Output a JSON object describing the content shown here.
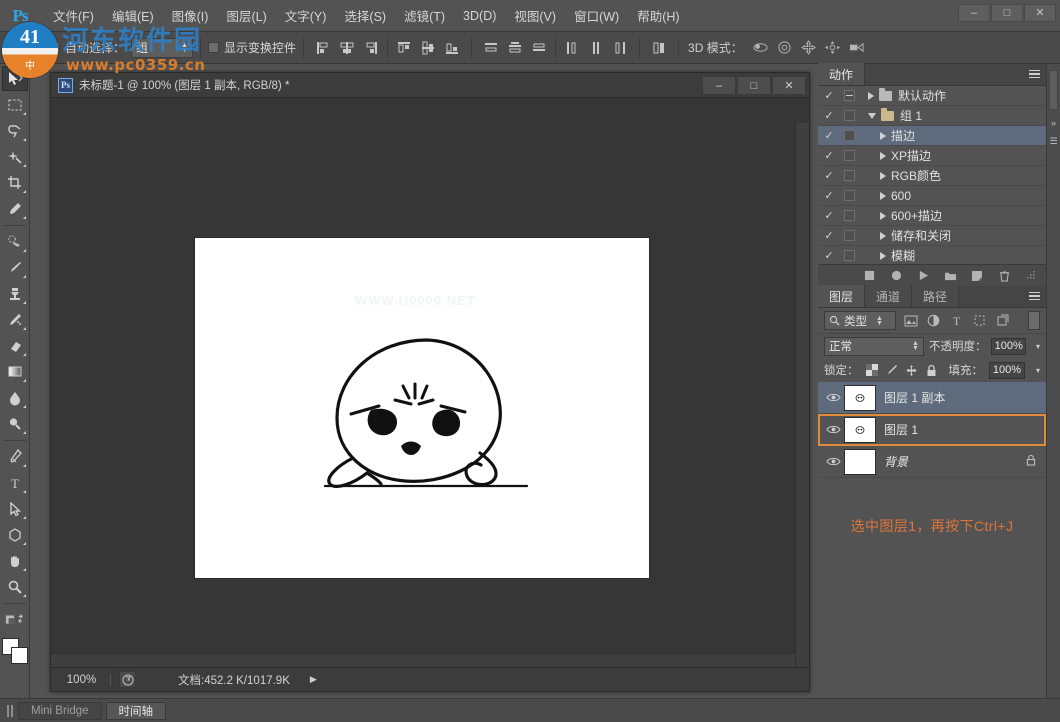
{
  "app": {
    "window_buttons": [
      "–",
      "□",
      "✕"
    ],
    "logo": "Ps"
  },
  "menu": {
    "items": [
      {
        "label": "文件(F)"
      },
      {
        "label": "编辑(E)"
      },
      {
        "label": "图像(I)"
      },
      {
        "label": "图层(L)"
      },
      {
        "label": "文字(Y)"
      },
      {
        "label": "选择(S)"
      },
      {
        "label": "滤镜(T)"
      },
      {
        "label": "3D(D)"
      },
      {
        "label": "视图(V)"
      },
      {
        "label": "窗口(W)"
      },
      {
        "label": "帮助(H)"
      }
    ]
  },
  "options_bar": {
    "auto_select_label": "自动选择：",
    "auto_select_value": "组",
    "show_transform_label": "显示变换控件",
    "d3_mode_label": "3D 模式：",
    "align_icons": [
      "align-left-edges-icon",
      "align-horizontal-centers-icon",
      "align-right-edges-icon",
      "align-top-edges-icon",
      "align-vertical-centers-icon",
      "align-bottom-edges-icon"
    ],
    "distribute_icons": [
      "distribute-top-edges-icon",
      "distribute-vertical-centers-icon",
      "distribute-bottom-edges-icon",
      "distribute-left-edges-icon",
      "distribute-horizontal-centers-icon",
      "distribute-right-edges-icon"
    ],
    "auto_align_icon": "auto-align-layers-icon",
    "d3_icons": [
      "3d-rotate-icon",
      "3d-roll-icon",
      "3d-drag-icon",
      "3d-slide-icon",
      "3d-scale-icon"
    ]
  },
  "toolbar": {
    "tools": [
      {
        "name": "move-tool",
        "active": true
      },
      {
        "name": "rectangular-marquee-tool",
        "active": false
      },
      {
        "name": "lasso-tool",
        "active": false
      },
      {
        "name": "magic-wand-tool",
        "active": false
      },
      {
        "name": "crop-tool",
        "active": false
      },
      {
        "name": "eyedropper-tool",
        "active": false
      },
      {
        "name": "spot-healing-brush-tool",
        "active": false
      },
      {
        "name": "brush-tool",
        "active": false
      },
      {
        "name": "clone-stamp-tool",
        "active": false
      },
      {
        "name": "history-brush-tool",
        "active": false
      },
      {
        "name": "eraser-tool",
        "active": false
      },
      {
        "name": "gradient-tool",
        "active": false
      },
      {
        "name": "blur-tool",
        "active": false
      },
      {
        "name": "dodge-tool",
        "active": false
      },
      {
        "name": "pen-tool",
        "active": false
      },
      {
        "name": "horizontal-type-tool",
        "active": false
      },
      {
        "name": "path-selection-tool",
        "active": false
      },
      {
        "name": "polygon-shape-tool",
        "active": false
      },
      {
        "name": "hand-tool",
        "active": false
      },
      {
        "name": "zoom-tool",
        "active": false
      }
    ],
    "foreground_color": "#ffffff",
    "background_color": "#ffffff"
  },
  "document": {
    "title": "未标题-1 @ 100% (图层 1 副本, RGB/8) *",
    "badge": "Ps",
    "window_buttons": [
      "–",
      "□",
      "✕"
    ],
    "canvas_watermark": "WWW.U0000.NET",
    "statusbar": {
      "zoom": "100%",
      "doc_label": "文档:452.2 K/1017.9K",
      "arrow": "▶"
    }
  },
  "actions_panel": {
    "tab": "动作",
    "rows": [
      {
        "label": "默认动作",
        "indent": 0,
        "checked": true,
        "box": "dash",
        "arrow": "right",
        "folder": "closed",
        "selected": false
      },
      {
        "label": "组 1",
        "indent": 0,
        "checked": true,
        "box": "empty",
        "arrow": "down",
        "folder": "open",
        "selected": false
      },
      {
        "label": "描边",
        "indent": 1,
        "checked": true,
        "box": "empty",
        "arrow": "right",
        "folder": "none",
        "selected": true
      },
      {
        "label": "XP描边",
        "indent": 1,
        "checked": true,
        "box": "empty",
        "arrow": "right",
        "folder": "none",
        "selected": false
      },
      {
        "label": "RGB颜色",
        "indent": 1,
        "checked": true,
        "box": "empty",
        "arrow": "right",
        "folder": "none",
        "selected": false
      },
      {
        "label": "600",
        "indent": 1,
        "checked": true,
        "box": "empty",
        "arrow": "right",
        "folder": "none",
        "selected": false
      },
      {
        "label": "600+描边",
        "indent": 1,
        "checked": true,
        "box": "empty",
        "arrow": "right",
        "folder": "none",
        "selected": false
      },
      {
        "label": "储存和关闭",
        "indent": 1,
        "checked": true,
        "box": "empty",
        "arrow": "right",
        "folder": "none",
        "selected": false
      },
      {
        "label": "模糊",
        "indent": 1,
        "checked": true,
        "box": "empty",
        "arrow": "right",
        "folder": "none",
        "selected": false
      }
    ],
    "footer_icons": [
      "stop-icon",
      "record-icon",
      "play-icon",
      "new-set-icon",
      "new-action-icon",
      "delete-icon"
    ]
  },
  "layers_panel": {
    "tabs": [
      {
        "label": "图层",
        "active": true
      },
      {
        "label": "通道",
        "active": false
      },
      {
        "label": "路径",
        "active": false
      }
    ],
    "filter": {
      "search_icon": "search-icon",
      "type_label": "类型",
      "icons": [
        "filter-pixel-icon",
        "filter-adjustment-icon",
        "filter-type-icon",
        "filter-shape-icon",
        "filter-smart-object-icon"
      ]
    },
    "blend": {
      "mode": "正常",
      "opacity_label": "不透明度：",
      "opacity_value": "100%",
      "fill_label": "填充：",
      "fill_value": "100%"
    },
    "lock": {
      "label": "锁定：",
      "icons": [
        "lock-transparent-pixels-icon",
        "lock-image-pixels-icon",
        "lock-position-icon",
        "lock-all-icon"
      ]
    },
    "layers": [
      {
        "name": "图层 1 副本",
        "visible": true,
        "thumb": "transparent",
        "selected": true,
        "outlined": false,
        "locked": false,
        "italic": false
      },
      {
        "name": "图层 1",
        "visible": true,
        "thumb": "transparent",
        "selected": false,
        "outlined": true,
        "locked": false,
        "italic": false
      },
      {
        "name": "背景",
        "visible": true,
        "thumb": "white",
        "selected": false,
        "outlined": false,
        "locked": true,
        "italic": true
      }
    ],
    "annotation": "选中图层1，再按下Ctrl+J",
    "annotation_color": "#e0743a"
  },
  "bottom_bar": {
    "tabs": [
      {
        "label": "Mini Bridge",
        "active": false
      },
      {
        "label": "时间轴",
        "active": true
      }
    ]
  },
  "site_watermark": {
    "name": "河东软件园",
    "url": "www.pc0359.cn",
    "logo_letter": "中",
    "logo_top": "41"
  }
}
